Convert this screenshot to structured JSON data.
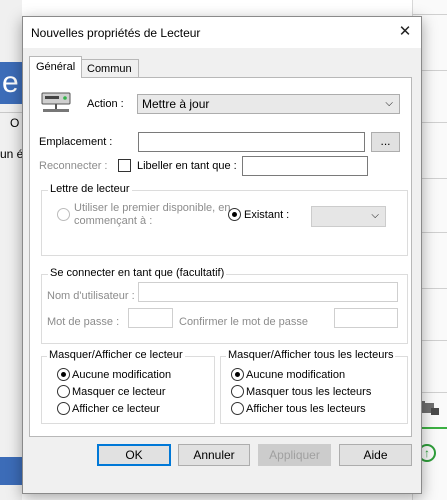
{
  "background": {
    "app_letter": "e",
    "row_label": "O",
    "cell_text": "un é"
  },
  "dialog": {
    "title": "Nouvelles propriétés de Lecteur",
    "close_glyph": "✕",
    "tabs": [
      "Général",
      "Commun"
    ],
    "action": {
      "label": "Action :",
      "value": "Mettre à jour"
    },
    "emplacement": {
      "label": "Emplacement :",
      "value": "",
      "browse_label": "..."
    },
    "reconnecter": {
      "label": "Reconnecter :",
      "checked": false
    },
    "libeller": {
      "label": "Libeller en tant que :",
      "value": ""
    },
    "drive_letter": {
      "legend": "Lettre de lecteur",
      "first_available_label": "Utiliser le premier disponible, en commençant à :",
      "existing_label": "Existant :",
      "existing_value": ""
    },
    "connect_as": {
      "legend": "Se connecter en tant que (facultatif)",
      "username_label": "Nom d'utilisateur :",
      "username_value": "",
      "password_label": "Mot de passe :",
      "confirm_label": "Confirmer le mot de passe"
    },
    "hide_show_drive": {
      "legend": "Masquer/Afficher ce lecteur",
      "options": [
        "Aucune modification",
        "Masquer ce lecteur",
        "Afficher ce lecteur"
      ],
      "selected": 0
    },
    "hide_show_all": {
      "legend": "Masquer/Afficher tous les lecteurs",
      "options": [
        "Aucune modification",
        "Masquer tous les lecteurs",
        "Afficher tous les lecteurs"
      ],
      "selected": 0
    },
    "buttons": {
      "ok": "OK",
      "cancel": "Annuler",
      "apply": "Appliquer",
      "help": "Aide"
    }
  },
  "colors": {
    "accent": "#0078d7",
    "app_blue": "#3c6cb8",
    "green": "#2e9e3a"
  }
}
